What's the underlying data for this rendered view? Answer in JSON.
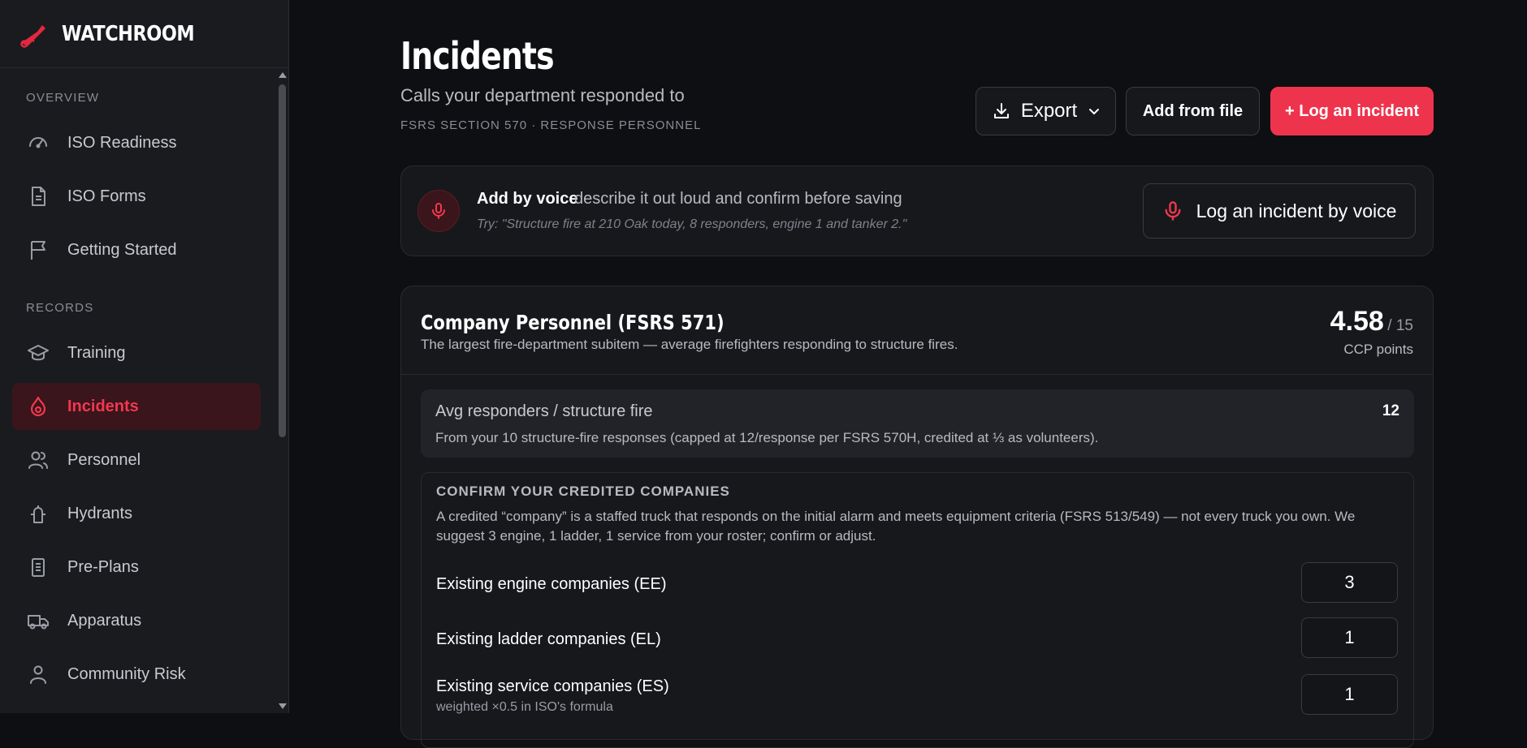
{
  "brand": {
    "name": "WATCHROOM"
  },
  "sidebar": {
    "sections": [
      {
        "label": "OVERVIEW"
      },
      {
        "label": "RECORDS"
      }
    ],
    "items": [
      {
        "label": "ISO Readiness",
        "icon": "gauge-icon"
      },
      {
        "label": "ISO Forms",
        "icon": "document-icon"
      },
      {
        "label": "Getting Started",
        "icon": "flag-icon"
      },
      {
        "label": "Training",
        "icon": "graduation-cap-icon"
      },
      {
        "label": "Incidents",
        "icon": "flame-icon",
        "active": true
      },
      {
        "label": "Personnel",
        "icon": "users-icon"
      },
      {
        "label": "Hydrants",
        "icon": "hydrant-icon"
      },
      {
        "label": "Pre-Plans",
        "icon": "clipboard-icon"
      },
      {
        "label": "Apparatus",
        "icon": "truck-icon"
      },
      {
        "label": "Community Risk",
        "icon": "user-icon"
      }
    ]
  },
  "header": {
    "title": "Incidents",
    "subtitle": "Calls your department responded to",
    "tag": "FSRS SECTION 570 · RESPONSE PERSONNEL",
    "export_label": "Export",
    "add_file_label": "Add from file",
    "log_label": "+ Log an incident"
  },
  "voice": {
    "title": "Add by voice",
    "description": "describe it out loud and confirm before saving",
    "hint": "Try: \"Structure fire at 210 Oak today, 8 responders, engine 1 and tanker 2.\"",
    "button_label": "Log an incident by voice"
  },
  "company": {
    "title": "Company Personnel (FSRS 571)",
    "description": "The largest fire-department subitem — average firefighters responding to structure fires.",
    "score": "4.58",
    "score_max": "/ 15",
    "score_unit": "CCP points",
    "avg": {
      "label": "Avg responders / structure fire",
      "value": "12",
      "note": "From your 10 structure-fire responses (capped at 12/response per FSRS 570H, credited at ⅓ as volunteers)."
    },
    "confirm": {
      "title": "CONFIRM YOUR CREDITED COMPANIES",
      "description": "A credited “company” is a staffed truck that responds on the initial alarm and meets equipment criteria (FSRS 513/549) — not every truck you own. We suggest 3 engine, 1 ladder, 1 service from your roster; confirm or adjust.",
      "rows": [
        {
          "label": "Existing engine companies (EE)",
          "value": "3"
        },
        {
          "label": "Existing ladder companies (EL)",
          "value": "1"
        },
        {
          "label": "Existing service companies (ES)",
          "value": "1",
          "sub": "weighted ×0.5 in ISO's formula"
        }
      ]
    }
  },
  "colors": {
    "accent": "#ee344d",
    "background": "#0e0f12",
    "surface": "#17181c"
  }
}
